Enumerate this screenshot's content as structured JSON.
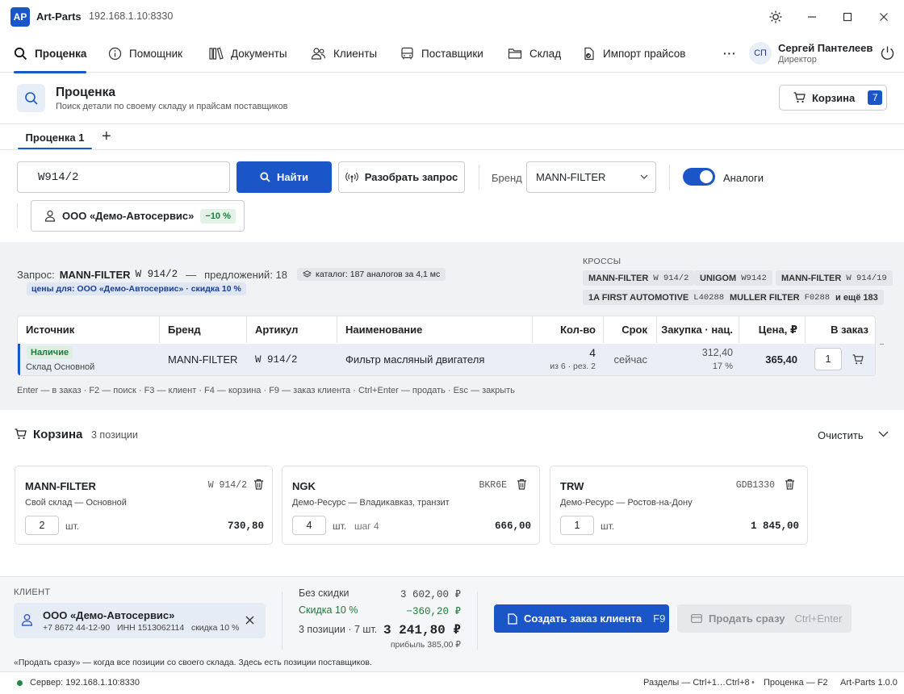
{
  "app": {
    "logo": "AP",
    "title": "Art-Parts",
    "address": "192.168.1.10:8330"
  },
  "nav": {
    "items": [
      {
        "label": "Проценка",
        "icon": "search-icon",
        "active": true
      },
      {
        "label": "Помощник",
        "icon": "info-icon"
      },
      {
        "label": "Документы",
        "icon": "books-icon"
      },
      {
        "label": "Клиенты",
        "icon": "users-icon"
      },
      {
        "label": "Поставщики",
        "icon": "bus-icon"
      },
      {
        "label": "Склад",
        "icon": "folder-icon"
      },
      {
        "label": "Импорт прайсов",
        "icon": "file-import-icon"
      }
    ],
    "more": "···",
    "user": {
      "initials": "СП",
      "name": "Сергей Пантелеев",
      "role": "Директор"
    }
  },
  "header": {
    "title": "Проценка",
    "subtitle": "Поиск детали по своему складу и прайсам поставщиков",
    "cart_label": "Корзина",
    "cart_count": "7"
  },
  "tabs": {
    "items": [
      "Проценка 1"
    ],
    "add": "+"
  },
  "search": {
    "query": "W914/2",
    "find_label": "Найти",
    "parse_label": "Разобрать запрос",
    "brand_label": "Бренд",
    "brand_value": "MANN-FILTER",
    "analogs_label": "Аналоги",
    "analogs_on": true,
    "client_name": "ООО «Демо-Автосервис»",
    "client_discount": "−10 %"
  },
  "query_info": {
    "prefix": "Запрос:",
    "brand": "MANN-FILTER",
    "article": "W 914/2",
    "dash": "—",
    "offers": "предложений: 18",
    "catalog": "каталог: 187 аналогов за 4,1 мс",
    "prices_for": "цены для: ООО «Демо-Автосервис» · скидка 10 %"
  },
  "crosses": {
    "label": "КРОССЫ",
    "items": [
      {
        "brand": "MANN-FILTER",
        "code": "W 914/2"
      },
      {
        "brand": "UNIGOM",
        "code": "W9142"
      },
      {
        "brand": "MANN-FILTER",
        "code": "W 914/19"
      },
      {
        "brand": "1A FIRST AUTOMOTIVE",
        "code": "L40288"
      },
      {
        "brand": "MULLER FILTER",
        "code": "F0288"
      },
      {
        "brand": "и ещё 183",
        "code": ""
      }
    ]
  },
  "table": {
    "headers": {
      "source": "Источник",
      "brand": "Бренд",
      "article": "Артикул",
      "name": "Наименование",
      "qty": "Кол-во",
      "term": "Срок",
      "purchase": "Закупка · нац.",
      "price": "Цена, ₽",
      "order": "В заказ"
    },
    "rows": [
      {
        "badge": "Наличие",
        "source": "Склад Основной",
        "brand": "MANN-FILTER",
        "article": "W 914/2",
        "name": "Фильтр масляный двигателя",
        "qty": "4",
        "qty_sub": "из 6 · рез. 2",
        "term": "сейчас",
        "purchase": "312,40",
        "markup": "17 %",
        "price": "365,40",
        "order_qty": "1"
      }
    ]
  },
  "hotkeys": "Enter — в заказ   ·   F2 — поиск   ·   F3 — клиент   ·   F4 — корзина   ·   F9 — заказ клиента   ·   Ctrl+Enter — продать   ·   Esc — закрыть",
  "cart": {
    "title": "Корзина",
    "count": "3 позиции",
    "clear": "Очистить",
    "items": [
      {
        "brand": "MANN-FILTER",
        "code": "W 914/2",
        "source": "Свой склад — Основной",
        "qty": "2",
        "unit": "шт.",
        "step": "",
        "sum": "730,80"
      },
      {
        "brand": "NGK",
        "code": "BKR6E",
        "source": "Демо-Ресурс — Владикавказ, транзит",
        "qty": "4",
        "unit": "шт.",
        "step": "шаг 4",
        "sum": "666,00"
      },
      {
        "brand": "TRW",
        "code": "GDB1330",
        "source": "Демо-Ресурс — Ростов-на-Дону",
        "qty": "1",
        "unit": "шт.",
        "step": "",
        "sum": "1 845,00"
      }
    ]
  },
  "footer": {
    "client_label": "КЛИЕНТ",
    "client_name": "ООО «Демо-Автосервис»",
    "client_details": "+7 8672 44-12-90   ИНН 1513062114   скидка 10 %",
    "no_discount_label": "Без скидки",
    "no_discount_value": "3 602,00 ₽",
    "discount_label": "Скидка 10 %",
    "discount_value": "−360,20 ₽",
    "positions": "3 позиции · 7 шт.",
    "total": "3 241,80 ₽",
    "profit": "прибыль 385,00 ₽",
    "create_order": "Создать заказ клиента",
    "create_order_key": "F9",
    "sell_now": "Продать сразу",
    "sell_now_key": "Ctrl+Enter",
    "note": "«Продать сразу» — когда все позиции со своего склада. Здесь есть позиции поставщиков."
  },
  "status": {
    "server": "Сервер: 192.168.1.10:8330",
    "sections": "Разделы — Ctrl+1…Ctrl+8",
    "estimate": "Проценка — F2",
    "version": "Art-Parts 1.0.0"
  },
  "colors": {
    "accent": "#1a56c8",
    "success": "#1e7a3a",
    "status_dot": "#1e8a45"
  }
}
